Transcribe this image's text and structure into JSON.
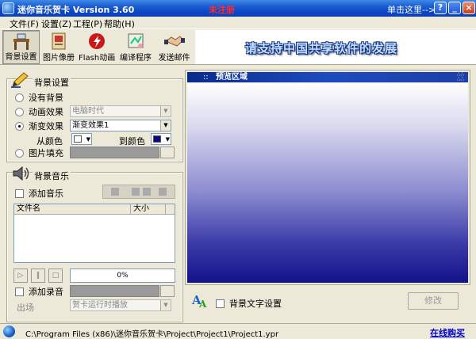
{
  "window": {
    "title": "迷你音乐贺卡 Version 3.60",
    "status": "未注册",
    "click_here": "单击这里-->>",
    "help_btn": "?",
    "min_btn": "_",
    "close_btn": "×"
  },
  "menu": [
    {
      "label": "文件(F)"
    },
    {
      "label": "设置(Z)"
    },
    {
      "label": "工程(P)"
    },
    {
      "label": "帮助(H)"
    }
  ],
  "toolbar": [
    {
      "label": "背景设置",
      "active": true
    },
    {
      "label": "图片像册",
      "active": false
    },
    {
      "label": "Flash动画",
      "active": false
    },
    {
      "label": "编译程序",
      "active": false
    },
    {
      "label": "发送邮件",
      "active": false
    }
  ],
  "banner": {
    "text": "请支持中国共享软件的发展"
  },
  "background": {
    "title": "背景设置",
    "options": [
      {
        "label": "没有背景",
        "checked": false
      },
      {
        "label": "动画效果",
        "checked": false
      },
      {
        "label": "渐变效果",
        "checked": true
      },
      {
        "label": "图片填充",
        "checked": false
      }
    ],
    "animation_value": "电脑时代",
    "gradient_value": "渐变效果1",
    "from_color_label": "从颜色",
    "to_color_label": "到颜色",
    "from_color": "#ffffff",
    "to_color": "#0a0a80"
  },
  "music": {
    "title": "背景音乐",
    "add_music": "添加音乐",
    "columns": [
      "文件名",
      "大小"
    ],
    "progress": "0%",
    "progress_value": 0,
    "add_record": "添加录音",
    "exit_label": "出场",
    "exit_value": "贺卡运行时播放"
  },
  "preview": {
    "title": "预览区域",
    "dots": "::",
    "bg_text_label": "背景文字设置",
    "modify_btn": "修改"
  },
  "status": {
    "path": "C:\\Program Files (x86)\\迷你音乐贺卡\\Project\\Project1\\Project1.ypr",
    "buy_link": "在线购买"
  },
  "colors": {
    "titlebar": "#0a46c7",
    "window_bg": "#ece9d8",
    "status_red": "#ff2a2a",
    "link_blue": "#0000cc"
  }
}
